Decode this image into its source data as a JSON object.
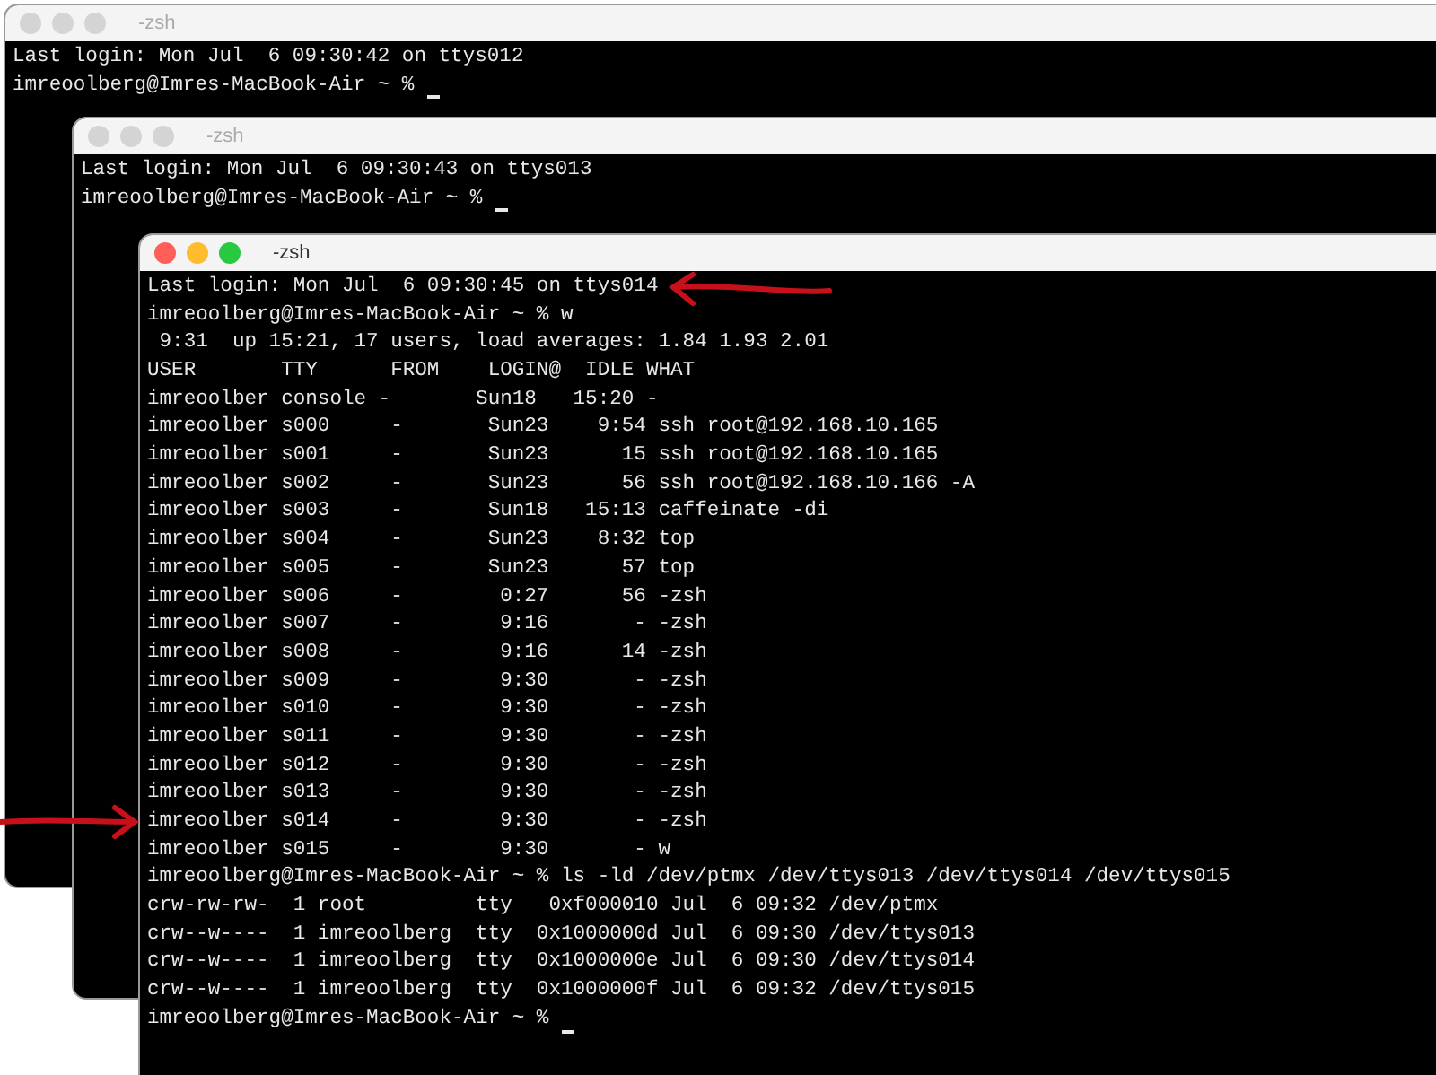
{
  "windows": [
    {
      "title": "-zsh",
      "active": false,
      "cursor": true,
      "lines": [
        "Last login: Mon Jul  6 09:30:42 on ttys012",
        "imreoolberg@Imres-MacBook-Air ~ % "
      ]
    },
    {
      "title": "-zsh",
      "active": false,
      "cursor": true,
      "lines": [
        "Last login: Mon Jul  6 09:30:43 on ttys013",
        "imreoolberg@Imres-MacBook-Air ~ % "
      ]
    },
    {
      "title": "-zsh",
      "active": true,
      "cursor": true,
      "lines": [
        "Last login: Mon Jul  6 09:30:45 on ttys014",
        "imreoolberg@Imres-MacBook-Air ~ % w",
        " 9:31  up 15:21, 17 users, load averages: 1.84 1.93 2.01",
        "USER       TTY      FROM    LOGIN@  IDLE WHAT",
        "imreoolber console -       Sun18   15:20 -",
        "imreoolber s000     -       Sun23    9:54 ssh root@192.168.10.165",
        "imreoolber s001     -       Sun23      15 ssh root@192.168.10.165",
        "imreoolber s002     -       Sun23      56 ssh root@192.168.10.166 -A",
        "imreoolber s003     -       Sun18   15:13 caffeinate -di",
        "imreoolber s004     -       Sun23    8:32 top",
        "imreoolber s005     -       Sun23      57 top",
        "imreoolber s006     -        0:27      56 -zsh",
        "imreoolber s007     -        9:16       - -zsh",
        "imreoolber s008     -        9:16      14 -zsh",
        "imreoolber s009     -        9:30       - -zsh",
        "imreoolber s010     -        9:30       - -zsh",
        "imreoolber s011     -        9:30       - -zsh",
        "imreoolber s012     -        9:30       - -zsh",
        "imreoolber s013     -        9:30       - -zsh",
        "imreoolber s014     -        9:30       - -zsh",
        "imreoolber s015     -        9:30       - w",
        "imreoolberg@Imres-MacBook-Air ~ % ls -ld /dev/ptmx /dev/ttys013 /dev/ttys014 /dev/ttys015",
        "crw-rw-rw-  1 root         tty   0xf000010 Jul  6 09:32 /dev/ptmx",
        "crw--w----  1 imreoolberg  tty  0x1000000d Jul  6 09:30 /dev/ttys013",
        "crw--w----  1 imreoolberg  tty  0x1000000e Jul  6 09:30 /dev/ttys014",
        "crw--w----  1 imreoolberg  tty  0x1000000f Jul  6 09:32 /dev/ttys015",
        "imreoolberg@Imres-MacBook-Air ~ % "
      ]
    }
  ]
}
